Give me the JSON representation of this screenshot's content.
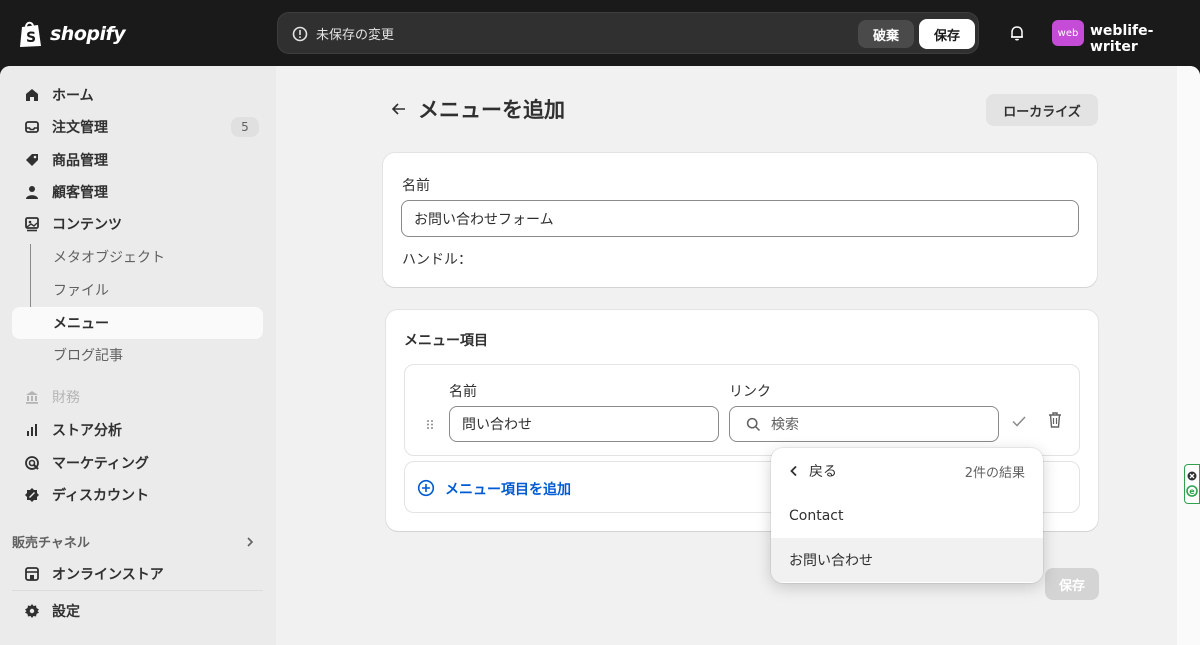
{
  "topbar": {
    "brand": "shopify",
    "unsaved_message": "未保存の変更",
    "discard_label": "破棄",
    "save_label": "保存",
    "store_avatar": "web",
    "store_name": "weblife-writer"
  },
  "sidebar": {
    "items": [
      {
        "label": "ホーム",
        "icon": "home-icon"
      },
      {
        "label": "注文管理",
        "icon": "inbox-icon",
        "badge": "5"
      },
      {
        "label": "商品管理",
        "icon": "tag-icon"
      },
      {
        "label": "顧客管理",
        "icon": "person-icon"
      },
      {
        "label": "コンテンツ",
        "icon": "image-icon"
      },
      {
        "label": "メタオブジェクト"
      },
      {
        "label": "ファイル"
      },
      {
        "label": "メニュー"
      },
      {
        "label": "ブログ記事"
      },
      {
        "label": "財務",
        "icon": "bank-icon"
      },
      {
        "label": "ストア分析",
        "icon": "bar-chart-icon"
      },
      {
        "label": "マーケティング",
        "icon": "target-icon"
      },
      {
        "label": "ディスカウント",
        "icon": "discount-icon"
      },
      {
        "label": "オンラインストア",
        "icon": "store-icon"
      },
      {
        "label": "設定",
        "icon": "gear-icon"
      }
    ],
    "sales_channels_label": "販売チャネル"
  },
  "page": {
    "title": "メニューを追加",
    "localize_label": "ローカライズ",
    "name_label": "名前",
    "name_value": "お問い合わせフォーム",
    "handle_label": "ハンドル："
  },
  "menu_items": {
    "title": "メニュー項目",
    "col_name": "名前",
    "col_link": "リンク",
    "item_name_value": "問い合わせ",
    "link_placeholder": "検索",
    "add_label": "メニュー項目を追加"
  },
  "popover": {
    "back_label": "戻る",
    "result_count": "2件の結果",
    "options": [
      "Contact",
      "お問い合わせ"
    ]
  },
  "footer": {
    "save_label": "保存"
  }
}
